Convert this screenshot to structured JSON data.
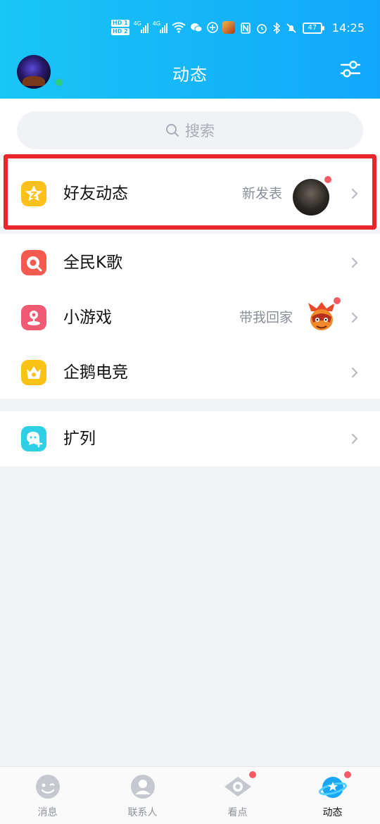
{
  "status_bar": {
    "hd1": "HD 1",
    "hd2": "HD 2",
    "net1": "4G",
    "net2": "4G",
    "battery": "47",
    "time": "14:25"
  },
  "header": {
    "title": "动态",
    "avatar_icon": "user-avatar",
    "settings_icon": "sliders-icon"
  },
  "search": {
    "placeholder": "搜索"
  },
  "rows": {
    "friends_feed": {
      "label": "好友动态",
      "note": "新发表"
    },
    "karaoke": {
      "label": "全民K歌"
    },
    "mini_games": {
      "label": "小游戏",
      "note": "带我回家"
    },
    "esports": {
      "label": "企鹅电竞"
    },
    "expand": {
      "label": "扩列"
    }
  },
  "bottom_nav": {
    "messages": "消息",
    "contacts": "联系人",
    "watch": "看点",
    "feed": "动态"
  },
  "colors": {
    "header_start": "#19c6f5",
    "header_end": "#12a7fb",
    "highlight": "#e9262b",
    "badge": "#f25b64",
    "online": "#2fd07a"
  }
}
